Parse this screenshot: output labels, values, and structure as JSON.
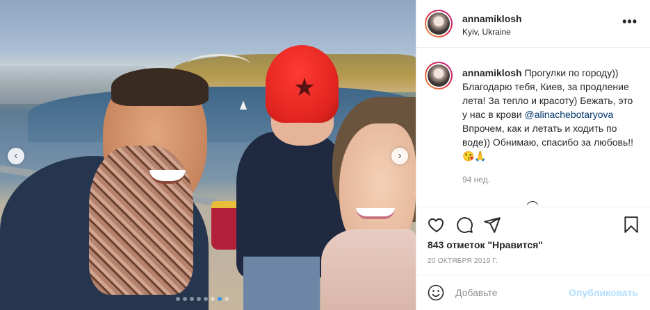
{
  "post": {
    "carousel": {
      "slide_count": 8,
      "active_index": 6
    }
  },
  "header": {
    "username": "annamiklosh",
    "location": "Kyiv, Ukraine",
    "more_label": "•••"
  },
  "caption": {
    "username": "annamiklosh",
    "text_before": "Прогулки по городу)) Благодарю тебя, Киев, за продление лета! За тепло и красоту) Бежать, это у нас в крови",
    "mention": "@alinachebotaryova",
    "text_after": "Впрочем, как и летать и ходить по воде)) Обнимаю, спасибо за любовь!! 😘🙏",
    "time_ago": "94 нед."
  },
  "stats": {
    "likes": "843 отметок \"Нравится\"",
    "date": "20 ОКТЯБРЯ 2019 Г."
  },
  "composer": {
    "placeholder": "Добавьте",
    "post_label": "Опубликовать"
  },
  "icons": {
    "like": "heart-icon",
    "comment": "comment-icon",
    "share": "send-icon",
    "save": "bookmark-icon",
    "emoji": "emoji-icon",
    "prev": "chevron-left-icon",
    "next": "chevron-right-icon"
  },
  "colors": {
    "link": "#00376b",
    "post_button_disabled": "#b2dffc",
    "active_dot": "#3897f0",
    "muted": "#8e8e8e"
  }
}
